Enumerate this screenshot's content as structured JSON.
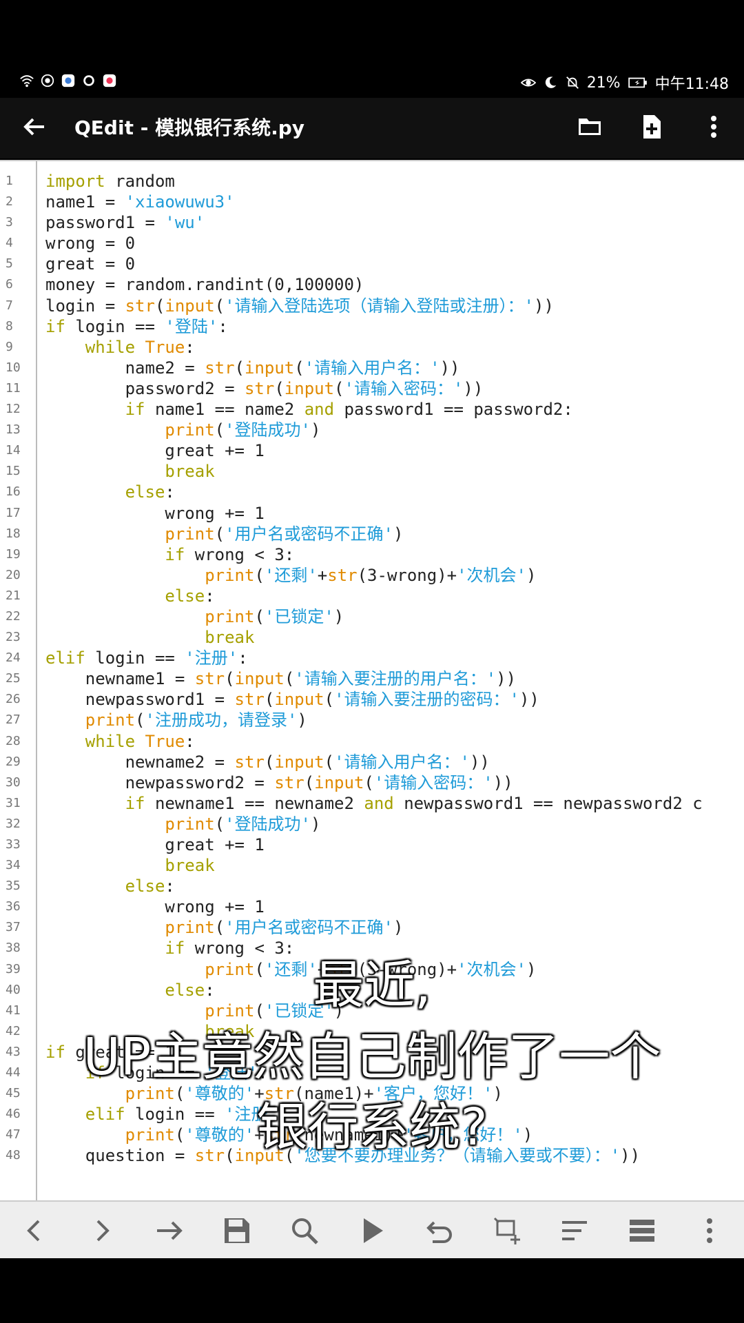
{
  "status": {
    "battery": "21%",
    "time": "中午11:48"
  },
  "appbar": {
    "title": "QEdit - 模拟银行系统.py"
  },
  "code_lines": [
    [
      [
        "import",
        "kw"
      ],
      [
        " random",
        ""
      ]
    ],
    [
      [
        "name1 = ",
        ""
      ],
      [
        "'xiaowuwu3'",
        "st"
      ]
    ],
    [
      [
        "password1 = ",
        ""
      ],
      [
        "'wu'",
        "st"
      ]
    ],
    [
      [
        "wrong = 0",
        ""
      ]
    ],
    [
      [
        "great = 0",
        ""
      ]
    ],
    [
      [
        "money = random.randint(0,100000)",
        ""
      ]
    ],
    [
      [
        "login = ",
        ""
      ],
      [
        "str",
        "bi"
      ],
      [
        "(",
        ""
      ],
      [
        "input",
        "bi"
      ],
      [
        "(",
        ""
      ],
      [
        "'请输入登陆选项（请输入登陆或注册）：'",
        "st"
      ],
      [
        "))",
        ""
      ]
    ],
    [
      [
        "if",
        "kw"
      ],
      [
        " login == ",
        ""
      ],
      [
        "'登陆'",
        "st"
      ],
      [
        ":",
        ""
      ]
    ],
    [
      [
        "    ",
        ""
      ],
      [
        "while",
        "kw"
      ],
      [
        " ",
        ""
      ],
      [
        "True",
        "bi"
      ],
      [
        ":",
        ""
      ]
    ],
    [
      [
        "        name2 = ",
        ""
      ],
      [
        "str",
        "bi"
      ],
      [
        "(",
        ""
      ],
      [
        "input",
        "bi"
      ],
      [
        "(",
        ""
      ],
      [
        "'请输入用户名：'",
        "st"
      ],
      [
        "))",
        ""
      ]
    ],
    [
      [
        "        password2 = ",
        ""
      ],
      [
        "str",
        "bi"
      ],
      [
        "(",
        ""
      ],
      [
        "input",
        "bi"
      ],
      [
        "(",
        ""
      ],
      [
        "'请输入密码：'",
        "st"
      ],
      [
        "))",
        ""
      ]
    ],
    [
      [
        "        ",
        ""
      ],
      [
        "if",
        "kw"
      ],
      [
        " name1 == name2 ",
        ""
      ],
      [
        "and",
        "kw"
      ],
      [
        " password1 == password2:",
        ""
      ]
    ],
    [
      [
        "            ",
        ""
      ],
      [
        "print",
        "bi"
      ],
      [
        "(",
        ""
      ],
      [
        "'登陆成功'",
        "st"
      ],
      [
        ")",
        ""
      ]
    ],
    [
      [
        "            great += 1",
        ""
      ]
    ],
    [
      [
        "            ",
        ""
      ],
      [
        "break",
        "kw"
      ]
    ],
    [
      [
        "        ",
        ""
      ],
      [
        "else",
        "kw"
      ],
      [
        ":",
        ""
      ]
    ],
    [
      [
        "            wrong += 1",
        ""
      ]
    ],
    [
      [
        "            ",
        ""
      ],
      [
        "print",
        "bi"
      ],
      [
        "(",
        ""
      ],
      [
        "'用户名或密码不正确'",
        "st"
      ],
      [
        ")",
        ""
      ]
    ],
    [
      [
        "            ",
        ""
      ],
      [
        "if",
        "kw"
      ],
      [
        " wrong < 3:",
        ""
      ]
    ],
    [
      [
        "                ",
        ""
      ],
      [
        "print",
        "bi"
      ],
      [
        "(",
        ""
      ],
      [
        "'还剩'",
        "st"
      ],
      [
        "+",
        ""
      ],
      [
        "str",
        "bi"
      ],
      [
        "(3-wrong)+",
        ""
      ],
      [
        "'次机会'",
        "st"
      ],
      [
        ")",
        ""
      ]
    ],
    [
      [
        "            ",
        ""
      ],
      [
        "else",
        "kw"
      ],
      [
        ":",
        ""
      ]
    ],
    [
      [
        "                ",
        ""
      ],
      [
        "print",
        "bi"
      ],
      [
        "(",
        ""
      ],
      [
        "'已锁定'",
        "st"
      ],
      [
        ")",
        ""
      ]
    ],
    [
      [
        "                ",
        ""
      ],
      [
        "break",
        "kw"
      ]
    ],
    [
      [
        "elif",
        "kw"
      ],
      [
        " login == ",
        ""
      ],
      [
        "'注册'",
        "st"
      ],
      [
        ":",
        ""
      ]
    ],
    [
      [
        "    newname1 = ",
        ""
      ],
      [
        "str",
        "bi"
      ],
      [
        "(",
        ""
      ],
      [
        "input",
        "bi"
      ],
      [
        "(",
        ""
      ],
      [
        "'请输入要注册的用户名：'",
        "st"
      ],
      [
        "))",
        ""
      ]
    ],
    [
      [
        "    newpassword1 = ",
        ""
      ],
      [
        "str",
        "bi"
      ],
      [
        "(",
        ""
      ],
      [
        "input",
        "bi"
      ],
      [
        "(",
        ""
      ],
      [
        "'请输入要注册的密码：'",
        "st"
      ],
      [
        "))",
        ""
      ]
    ],
    [
      [
        "    ",
        ""
      ],
      [
        "print",
        "bi"
      ],
      [
        "(",
        ""
      ],
      [
        "'注册成功，请登录'",
        "st"
      ],
      [
        ")",
        ""
      ]
    ],
    [
      [
        "    ",
        ""
      ],
      [
        "while",
        "kw"
      ],
      [
        " ",
        ""
      ],
      [
        "True",
        "bi"
      ],
      [
        ":",
        ""
      ]
    ],
    [
      [
        "        newname2 = ",
        ""
      ],
      [
        "str",
        "bi"
      ],
      [
        "(",
        ""
      ],
      [
        "input",
        "bi"
      ],
      [
        "(",
        ""
      ],
      [
        "'请输入用户名：'",
        "st"
      ],
      [
        "))",
        ""
      ]
    ],
    [
      [
        "        newpassword2 = ",
        ""
      ],
      [
        "str",
        "bi"
      ],
      [
        "(",
        ""
      ],
      [
        "input",
        "bi"
      ],
      [
        "(",
        ""
      ],
      [
        "'请输入密码：'",
        "st"
      ],
      [
        "))",
        ""
      ]
    ],
    [
      [
        "        ",
        ""
      ],
      [
        "if",
        "kw"
      ],
      [
        " newname1 == newname2 ",
        ""
      ],
      [
        "and",
        "kw"
      ],
      [
        " newpassword1 == newpassword2 c",
        ""
      ]
    ],
    [
      [
        "            ",
        ""
      ],
      [
        "print",
        "bi"
      ],
      [
        "(",
        ""
      ],
      [
        "'登陆成功'",
        "st"
      ],
      [
        ")",
        ""
      ]
    ],
    [
      [
        "            great += 1",
        ""
      ]
    ],
    [
      [
        "            ",
        ""
      ],
      [
        "break",
        "kw"
      ]
    ],
    [
      [
        "        ",
        ""
      ],
      [
        "else",
        "kw"
      ],
      [
        ":",
        ""
      ]
    ],
    [
      [
        "            wrong += 1",
        ""
      ]
    ],
    [
      [
        "            ",
        ""
      ],
      [
        "print",
        "bi"
      ],
      [
        "(",
        ""
      ],
      [
        "'用户名或密码不正确'",
        "st"
      ],
      [
        ")",
        ""
      ]
    ],
    [
      [
        "            ",
        ""
      ],
      [
        "if",
        "kw"
      ],
      [
        " wrong < 3:",
        ""
      ]
    ],
    [
      [
        "                ",
        ""
      ],
      [
        "print",
        "bi"
      ],
      [
        "(",
        ""
      ],
      [
        "'还剩'",
        "st"
      ],
      [
        "+",
        ""
      ],
      [
        "str",
        "bi"
      ],
      [
        "(3-wrong)+",
        ""
      ],
      [
        "'次机会'",
        "st"
      ],
      [
        ")",
        ""
      ]
    ],
    [
      [
        "            ",
        ""
      ],
      [
        "else",
        "kw"
      ],
      [
        ":",
        ""
      ]
    ],
    [
      [
        "                ",
        ""
      ],
      [
        "print",
        "bi"
      ],
      [
        "(",
        ""
      ],
      [
        "'已锁定'",
        "st"
      ],
      [
        ")",
        ""
      ]
    ],
    [
      [
        "                ",
        ""
      ],
      [
        "break",
        "kw"
      ]
    ],
    [
      [
        "if",
        "kw"
      ],
      [
        " great == 1:",
        ""
      ]
    ],
    [
      [
        "    ",
        ""
      ],
      [
        "if",
        "kw"
      ],
      [
        " login == ",
        ""
      ],
      [
        "'登陆'",
        "st"
      ],
      [
        ":",
        ""
      ]
    ],
    [
      [
        "        ",
        ""
      ],
      [
        "print",
        "bi"
      ],
      [
        "(",
        ""
      ],
      [
        "'尊敬的'",
        "st"
      ],
      [
        "+",
        ""
      ],
      [
        "str",
        "bi"
      ],
      [
        "(name1)+",
        ""
      ],
      [
        "'客户，您好！'",
        "st"
      ],
      [
        ")",
        ""
      ]
    ],
    [
      [
        "    ",
        ""
      ],
      [
        "elif",
        "kw"
      ],
      [
        " login == ",
        ""
      ],
      [
        "'注册'",
        "st"
      ],
      [
        ":",
        ""
      ]
    ],
    [
      [
        "        ",
        ""
      ],
      [
        "print",
        "bi"
      ],
      [
        "(",
        ""
      ],
      [
        "'尊敬的'",
        "st"
      ],
      [
        "+",
        ""
      ],
      [
        "str",
        "bi"
      ],
      [
        "(newname1)+",
        ""
      ],
      [
        "'客户，您好！'",
        "st"
      ],
      [
        ")",
        ""
      ]
    ],
    [
      [
        "    question = ",
        ""
      ],
      [
        "str",
        "bi"
      ],
      [
        "(",
        ""
      ],
      [
        "input",
        "bi"
      ],
      [
        "(",
        ""
      ],
      [
        "'您要不要办理业务？（请输入要或不要）：'",
        "st"
      ],
      [
        "))",
        ""
      ]
    ]
  ],
  "caption": {
    "line1": "最近,",
    "line2": "UP主竟然自己制作了一个",
    "line3": "银行系统?"
  }
}
